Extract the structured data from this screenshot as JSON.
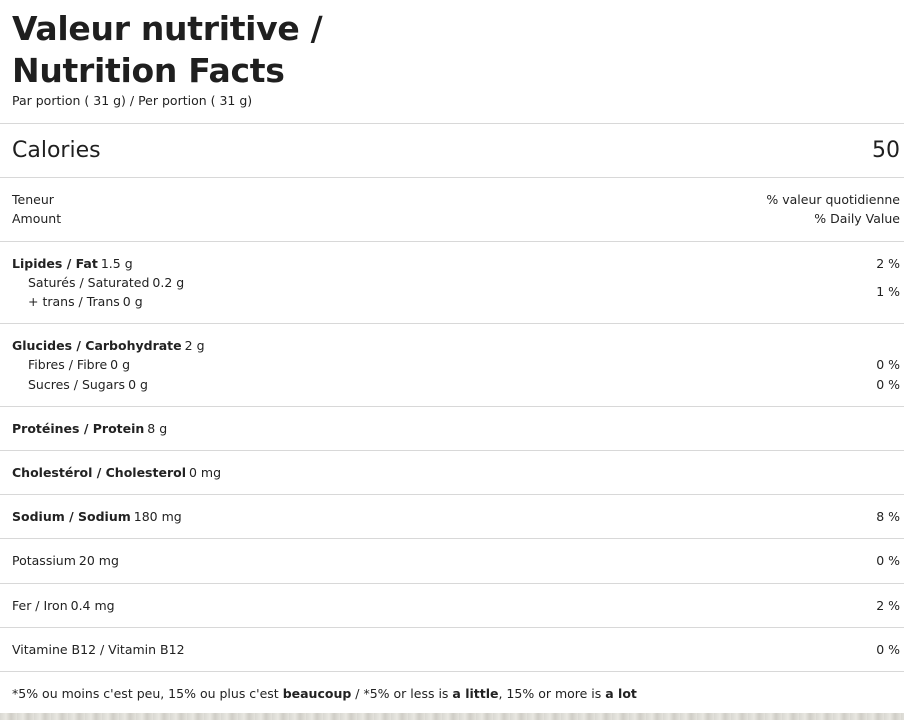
{
  "header": {
    "title_fr": "Valeur nutritive /",
    "title_en": "Nutrition Facts",
    "serving": "Par portion ( 31 g) / Per portion ( 31 g)"
  },
  "calories": {
    "label": "Calories",
    "value": "50"
  },
  "columns": {
    "amount_fr": "Teneur",
    "amount_en": "Amount",
    "dv_fr": "% valeur quotidienne",
    "dv_en": "% Daily Value"
  },
  "nutrients": {
    "fat": {
      "name": "Lipides / Fat",
      "amount": "1.5 g",
      "dv": "2 %"
    },
    "saturated": {
      "name": "Saturés / Saturated",
      "amount": "0.2 g",
      "dv": "1 %"
    },
    "trans": {
      "name": "+ trans / Trans",
      "amount": "0 g"
    },
    "carbohydrate": {
      "name": "Glucides / Carbohydrate",
      "amount": "2 g"
    },
    "fibre": {
      "name": "Fibres / Fibre",
      "amount": "0 g",
      "dv": "0 %"
    },
    "sugars": {
      "name": "Sucres / Sugars",
      "amount": "0 g",
      "dv": "0 %"
    },
    "protein": {
      "name": "Protéines / Protein",
      "amount": "8 g"
    },
    "cholesterol": {
      "name": "Cholestérol / Cholesterol",
      "amount": "0 mg"
    },
    "sodium": {
      "name": "Sodium / Sodium",
      "amount": "180 mg",
      "dv": "8 %"
    },
    "potassium": {
      "name": "Potassium",
      "amount": "20 mg",
      "dv": "0 %"
    },
    "iron": {
      "name": "Fer / Iron",
      "amount": "0.4 mg",
      "dv": "2 %"
    },
    "b12": {
      "name": "Vitamine B12 / Vitamin B12",
      "dv": "0 %"
    }
  },
  "footnote": {
    "fr_a": "*5% ou moins c'est peu, 15% ou plus c'est ",
    "fr_b": "beaucoup",
    "sep": " / ",
    "en_a": "*5% or less is ",
    "en_b": "a little",
    "en_c": ", 15% or more is ",
    "en_d": "a lot"
  }
}
